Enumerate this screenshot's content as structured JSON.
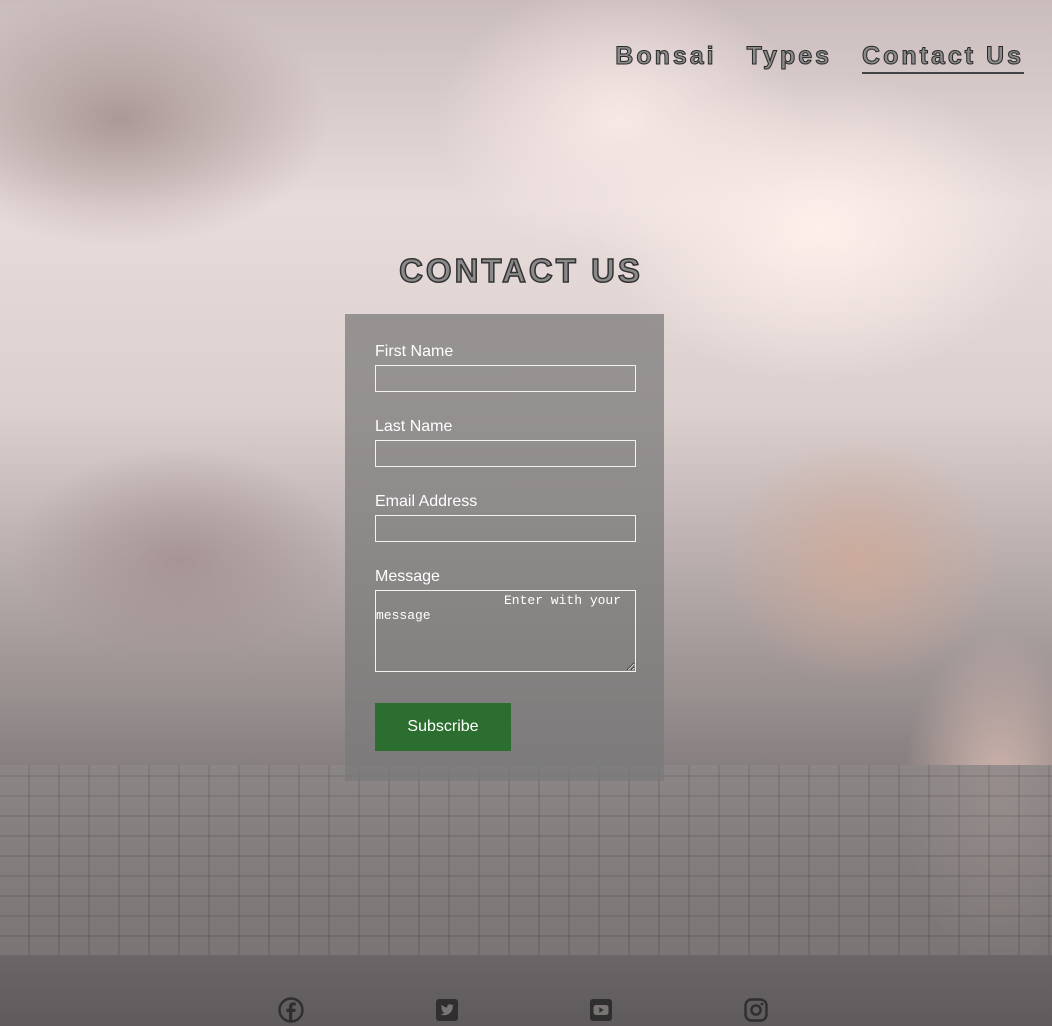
{
  "nav": {
    "items": [
      {
        "label": "Bonsai",
        "active": false
      },
      {
        "label": "Types",
        "active": false
      },
      {
        "label": "Contact Us",
        "active": true
      }
    ]
  },
  "page": {
    "title": "CONTACT US"
  },
  "form": {
    "first_name_label": "First Name",
    "first_name_value": "",
    "last_name_label": "Last Name",
    "last_name_value": "",
    "email_label": "Email Address",
    "email_value": "",
    "message_label": "Message",
    "message_placeholder": "Enter with your message",
    "submit_label": "Subscribe"
  },
  "social": {
    "icons": [
      "facebook-icon",
      "twitter-icon",
      "youtube-icon",
      "instagram-icon"
    ]
  },
  "colors": {
    "submit_button": "#2c6e2f",
    "panel": "#787878"
  }
}
